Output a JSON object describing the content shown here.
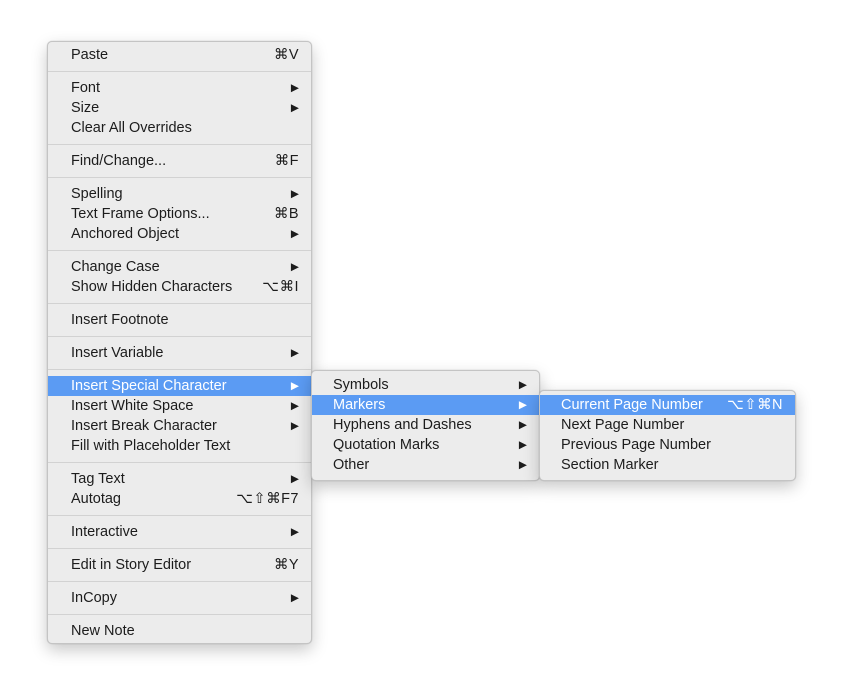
{
  "main_menu": {
    "items": [
      {
        "label": "Paste",
        "shortcut": "⌘V"
      },
      {
        "label": "Font",
        "arrow": "▶"
      },
      {
        "label": "Size",
        "arrow": "▶"
      },
      {
        "label": "Clear All Overrides"
      },
      {
        "label": "Find/Change...",
        "shortcut": "⌘F"
      },
      {
        "label": "Spelling",
        "arrow": "▶"
      },
      {
        "label": "Text Frame Options...",
        "shortcut": "⌘B"
      },
      {
        "label": "Anchored Object",
        "arrow": "▶"
      },
      {
        "label": "Change Case",
        "arrow": "▶"
      },
      {
        "label": "Show Hidden Characters",
        "shortcut": "⌥⌘I"
      },
      {
        "label": "Insert Footnote"
      },
      {
        "label": "Insert Variable",
        "arrow": "▶"
      },
      {
        "label": "Insert Special Character",
        "arrow": "▶"
      },
      {
        "label": "Insert White Space",
        "arrow": "▶"
      },
      {
        "label": "Insert Break Character",
        "arrow": "▶"
      },
      {
        "label": "Fill with Placeholder Text"
      },
      {
        "label": "Tag Text",
        "arrow": "▶"
      },
      {
        "label": "Autotag",
        "shortcut": "⌥⇧⌘F7"
      },
      {
        "label": "Interactive",
        "arrow": "▶"
      },
      {
        "label": "Edit in Story Editor",
        "shortcut": "⌘Y"
      },
      {
        "label": "InCopy",
        "arrow": "▶"
      },
      {
        "label": "New Note"
      }
    ]
  },
  "special_character_menu": {
    "items": [
      {
        "label": "Symbols",
        "arrow": "▶"
      },
      {
        "label": "Markers",
        "arrow": "▶"
      },
      {
        "label": "Hyphens and Dashes",
        "arrow": "▶"
      },
      {
        "label": "Quotation Marks",
        "arrow": "▶"
      },
      {
        "label": "Other",
        "arrow": "▶"
      }
    ]
  },
  "markers_menu": {
    "items": [
      {
        "label": "Current Page Number",
        "shortcut": "⌥⇧⌘N"
      },
      {
        "label": "Next Page Number"
      },
      {
        "label": "Previous Page Number"
      },
      {
        "label": "Section Marker"
      }
    ]
  },
  "colors": {
    "highlight": "#5b9bf3",
    "menu_background": "#ececec"
  }
}
